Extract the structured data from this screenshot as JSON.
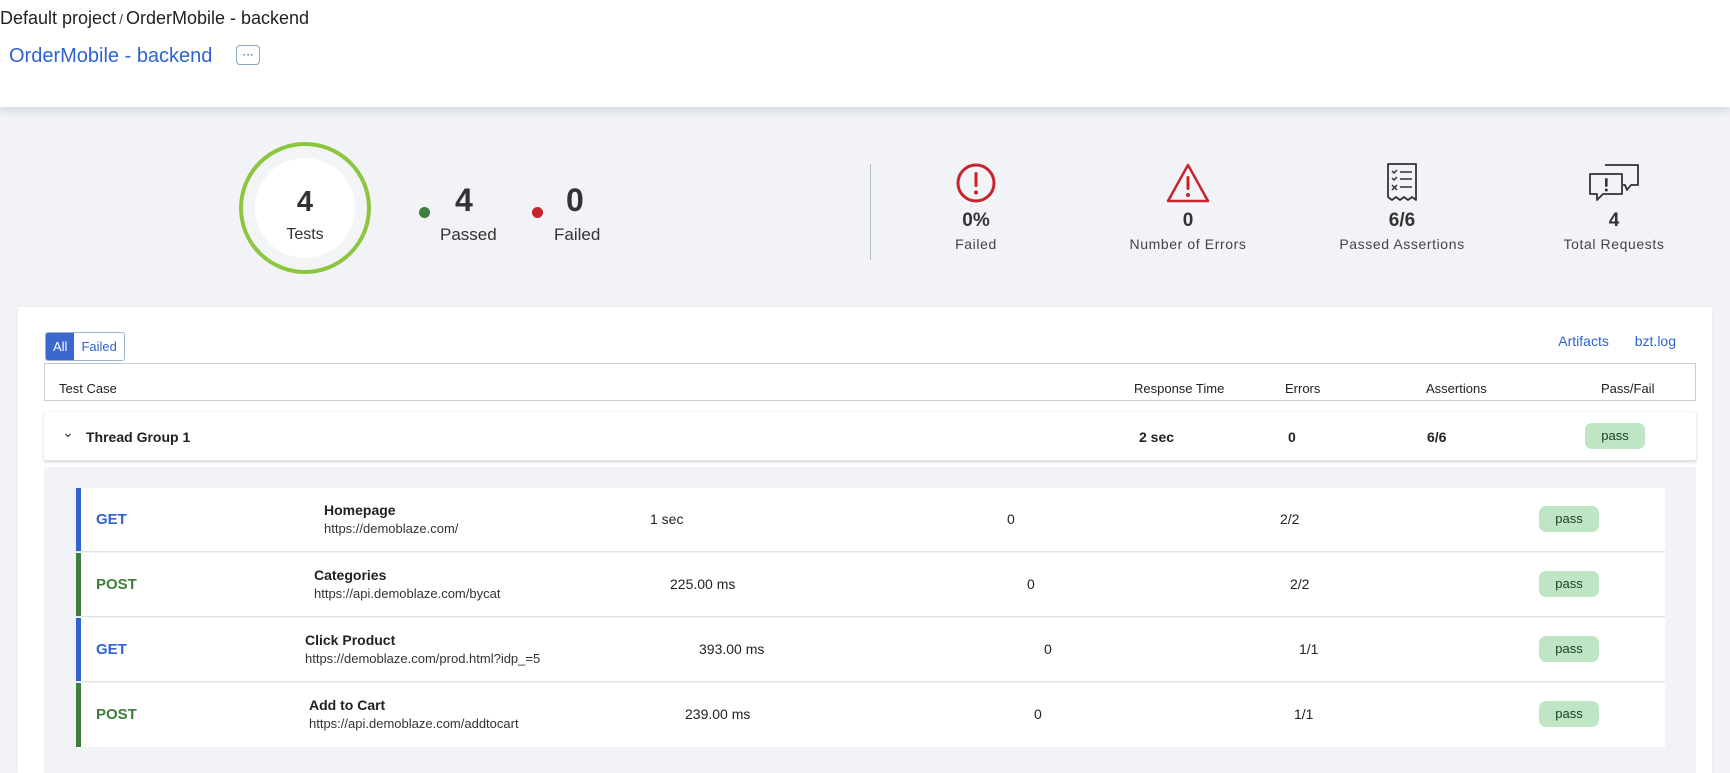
{
  "header": {
    "breadcrumb_project": "Default project",
    "breadcrumb_sep": "/",
    "breadcrumb_test": "OrderMobile - backend",
    "title": "OrderMobile - backend",
    "more_label": "···"
  },
  "summary": {
    "tests_count": "4",
    "tests_label": "Tests",
    "passed_count": "4",
    "passed_label": "Passed",
    "failed_count": "0",
    "failed_label": "Failed",
    "colors": {
      "passed": "#3c7e3c",
      "failed": "#c8242b",
      "ring": "#8cc63f",
      "accent": "#2f63d0"
    }
  },
  "metrics": [
    {
      "icon": "alert-circle-icon",
      "value": "0%",
      "label": "Failed"
    },
    {
      "icon": "warning-triangle-icon",
      "value": "0",
      "label": "Number of Errors"
    },
    {
      "icon": "checklist-icon",
      "value": "6/6",
      "label": "Passed Assertions"
    },
    {
      "icon": "chat-bubbles-icon",
      "value": "4",
      "label": "Total Requests"
    }
  ],
  "filters": {
    "all": "All",
    "failed": "Failed"
  },
  "links": {
    "artifacts": "Artifacts",
    "log": "bzt.log"
  },
  "columns": {
    "test_case": "Test Case",
    "response_time": "Response Time",
    "errors": "Errors",
    "assertions": "Assertions",
    "pass_fail": "Pass/Fail"
  },
  "group": {
    "name": "Thread Group 1",
    "response_time": "2 sec",
    "errors": "0",
    "assertions": "6/6",
    "status": "pass"
  },
  "requests": [
    {
      "method": "GET",
      "name": "Homepage",
      "url": "https://demoblaze.com/",
      "time": "1 sec",
      "errors": "0",
      "assertions": "2/2",
      "status": "pass"
    },
    {
      "method": "POST",
      "name": "Categories",
      "url": "https://api.demoblaze.com/bycat",
      "time": "225.00 ms",
      "errors": "0",
      "assertions": "2/2",
      "status": "pass"
    },
    {
      "method": "GET",
      "name": "Click Product",
      "url": "https://demoblaze.com/prod.html?idp_=5",
      "time": "393.00 ms",
      "errors": "0",
      "assertions": "1/1",
      "status": "pass"
    },
    {
      "method": "POST",
      "name": "Add to Cart",
      "url": "https://api.demoblaze.com/addtocart",
      "time": "239.00 ms",
      "errors": "0",
      "assertions": "1/1",
      "status": "pass"
    }
  ],
  "method_colors": {
    "GET": "#2f63d0",
    "POST": "#3c7e3c"
  }
}
